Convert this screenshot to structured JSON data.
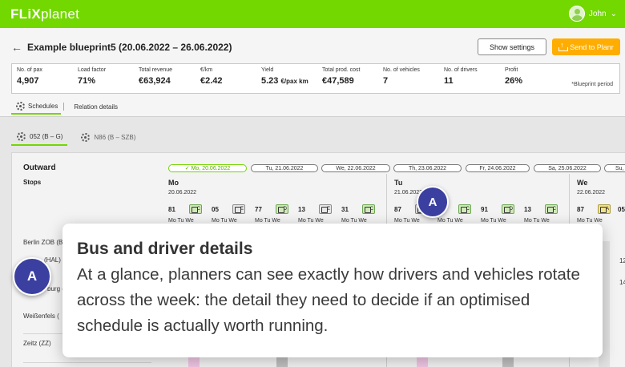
{
  "brand": {
    "strong": "FLiX",
    "light": "planet",
    "color": "#73d700"
  },
  "user": {
    "name": "John",
    "chevron": "chevron-down-icon"
  },
  "header": {
    "title": "Example blueprint5 (20.06.2022 – 26.06.2022)",
    "show_settings": "Show settings",
    "send_to_planr": "Send to Planr",
    "blueprint_note": "*Blueprint period"
  },
  "stats": [
    {
      "label": "No. of pax",
      "value": "4,907",
      "unit": ""
    },
    {
      "label": "Load factor",
      "value": "71%",
      "unit": ""
    },
    {
      "label": "Total revenue",
      "value": "€63,924",
      "unit": ""
    },
    {
      "label": "€/km",
      "value": "€2.42",
      "unit": ""
    },
    {
      "label": "Yield",
      "value": "5.23",
      "unit": "€/pax km"
    },
    {
      "label": "Total prod. cost",
      "value": "€47,589",
      "unit": ""
    },
    {
      "label": "No. of vehicles",
      "value": "7",
      "unit": ""
    },
    {
      "label": "No. of drivers",
      "value": "11",
      "unit": ""
    },
    {
      "label": "Profit",
      "value": "26%",
      "unit": ""
    }
  ],
  "tabs": {
    "schedules": "Schedules",
    "relation_details": "Relation details"
  },
  "route_tabs": [
    "052 (B – G)",
    "N86 (B – SZB)"
  ],
  "schedule": {
    "direction": "Outward",
    "stops_heading": "Stops",
    "date_pills": [
      "✓ Mo, 20.06.2022",
      "Tu, 21.06.2022",
      "We, 22.06.2022",
      "Th, 23.06.2022",
      "Fr, 24.06.2022",
      "Sa, 25.06.2022",
      "Su, 26.06.2022"
    ],
    "days": [
      {
        "name": "Mo",
        "date": "20.06.2022",
        "trips": [
          {
            "num": "81",
            "badge": "C",
            "color": "green"
          },
          {
            "num": "05",
            "badge": "E",
            "color": "grey"
          },
          {
            "num": "77",
            "badge": "D",
            "color": "green"
          },
          {
            "num": "13",
            "badge": "E",
            "color": "grey"
          },
          {
            "num": "31",
            "badge": "C",
            "color": "green"
          }
        ]
      },
      {
        "name": "Tu",
        "date": "21.06.2022",
        "trips": [
          {
            "num": "87",
            "badge": "A",
            "color": "grey"
          },
          {
            "num": "05",
            "badge": "C",
            "color": "green"
          },
          {
            "num": "91",
            "badge": "D",
            "color": "green"
          },
          {
            "num": "13",
            "badge": "C",
            "color": "green"
          }
        ]
      },
      {
        "name": "We",
        "date": "22.06.2022",
        "trips": [
          {
            "num": "87",
            "badge": "A",
            "color": "yellow"
          },
          {
            "num": "05",
            "badge": "",
            "color": "grey"
          }
        ]
      }
    ],
    "trip_days_label": "Mo Tu We",
    "trip_days_partial": "Mo Tu We",
    "stops": [
      "Berlin ZOB (B",
      "(HAL)",
      "burg (",
      "Weißenfels (",
      "Zeitz (ZZ)"
    ],
    "right_edge_numbers": [
      "12",
      "14"
    ]
  },
  "markers": [
    "A",
    "A",
    "A"
  ],
  "info": {
    "title": "Bus and driver details",
    "body": "At a glance, planners can see exactly how drivers and vehicles rotate across the week: the detail they need to decide if an optimised schedule is actually worth running."
  },
  "colors": {
    "accent": "#73d700",
    "send_button": "#ffad00",
    "marker": "#3a3fa0"
  }
}
